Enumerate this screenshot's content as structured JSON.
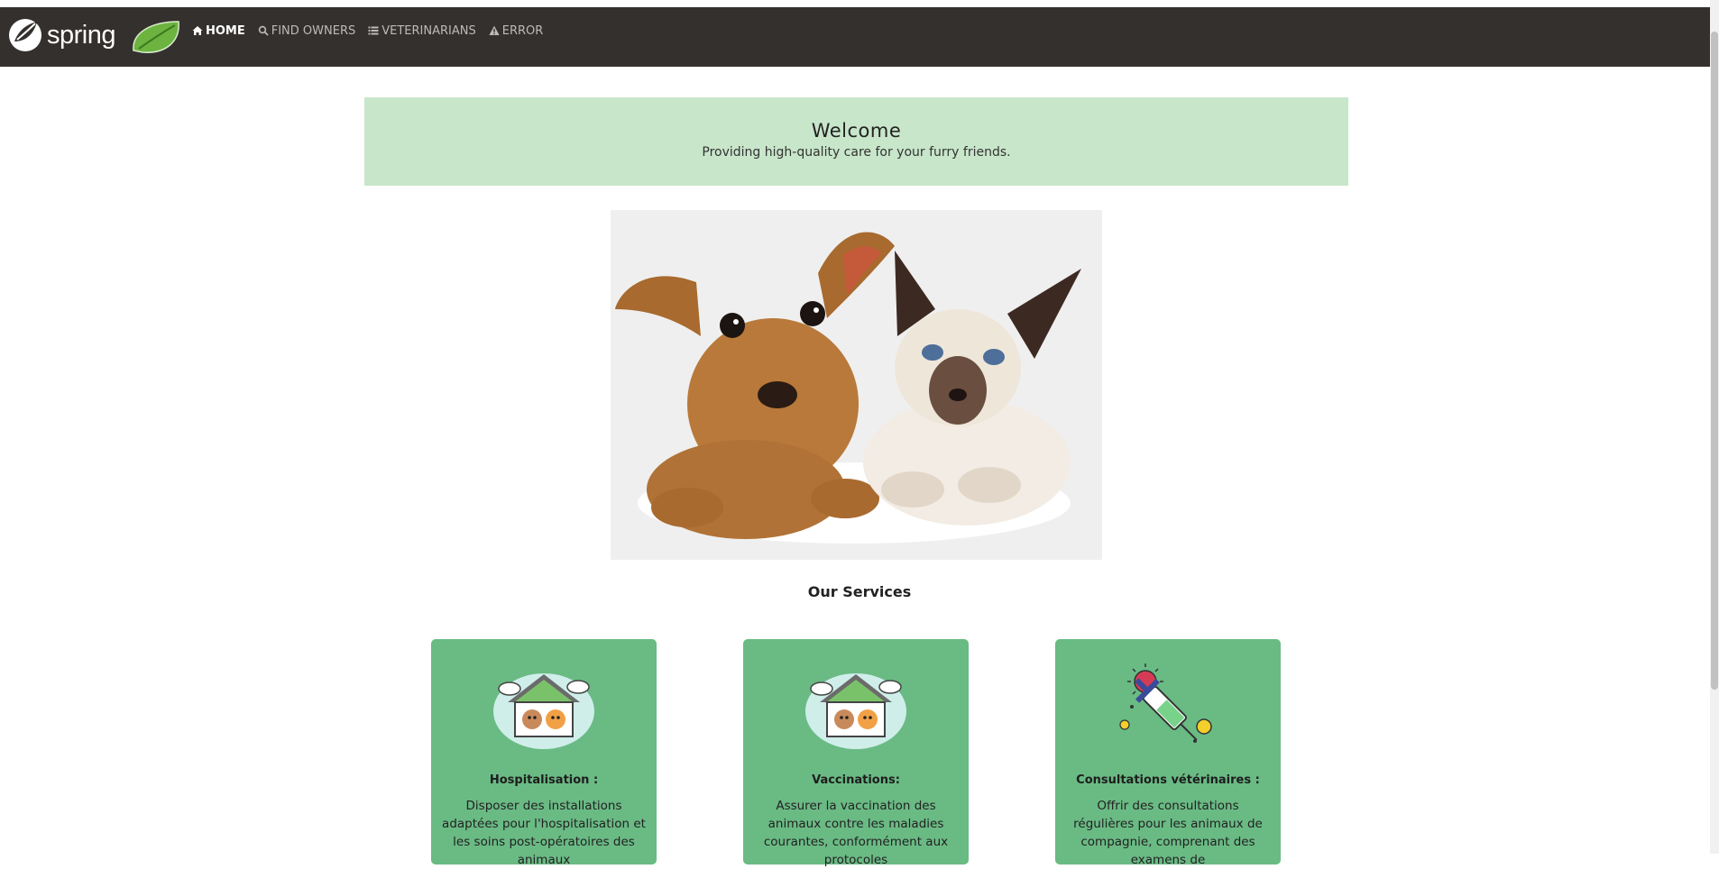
{
  "header": {
    "brand": "spring",
    "nav": [
      {
        "label": "HOME",
        "icon": "home-icon",
        "active": true
      },
      {
        "label": "FIND OWNERS",
        "icon": "search-icon",
        "active": false
      },
      {
        "label": "VETERINARIANS",
        "icon": "list-icon",
        "active": false
      },
      {
        "label": "ERROR",
        "icon": "warning-icon",
        "active": false
      }
    ],
    "colors": {
      "navbar": "#34302d",
      "active": "#ffffff",
      "inactive": "#bbbbbb",
      "leaf": "#6db33f"
    }
  },
  "welcome": {
    "title": "Welcome",
    "subtitle": "Providing high-quality care for your furry friends.",
    "background": "#c8e6ca"
  },
  "hero": {
    "icon": "puppy-kitten-photo"
  },
  "services": {
    "title": "Our Services",
    "card_color": "#6aba84",
    "items": [
      {
        "icon": "pet-house-icon",
        "title": "Hospitalisation :",
        "desc": "Disposer des installations adaptées pour l'hospitalisation et les soins post-opératoires des animaux"
      },
      {
        "icon": "pet-house-icon",
        "title": "Vaccinations:",
        "desc": "Assurer la vaccination des animaux contre les maladies courantes, conformément aux protocoles"
      },
      {
        "icon": "syringe-virus-icon",
        "title": "Consultations vétérinaires :",
        "desc": "Offrir des consultations régulières pour les animaux de compagnie, comprenant des examens de"
      }
    ]
  }
}
